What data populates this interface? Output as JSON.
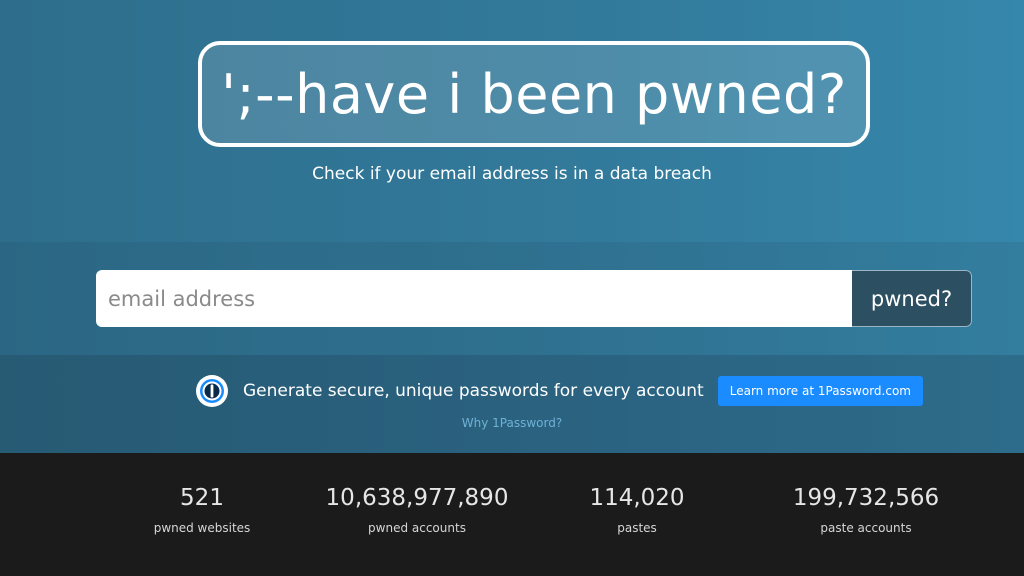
{
  "hero": {
    "logo_text": "';--have i been pwned?",
    "tagline": "Check if your email address is in a data breach"
  },
  "search": {
    "placeholder": "email address",
    "button_label": "pwned?"
  },
  "promo": {
    "icon": "1password-icon",
    "text": "Generate secure, unique passwords for every account",
    "button_label": "Learn more at 1Password.com",
    "why_link": "Why 1Password?"
  },
  "stats": [
    {
      "value": "521",
      "label": "pwned websites"
    },
    {
      "value": "10,638,977,890",
      "label": "pwned accounts"
    },
    {
      "value": "114,020",
      "label": "pastes"
    },
    {
      "value": "199,732,566",
      "label": "paste accounts"
    }
  ],
  "colors": {
    "hero": "#32799a",
    "search_button": "#2c4f62",
    "promo_button": "#1a8cff",
    "link": "#6fb1d6",
    "footer": "#1b1b1b"
  }
}
